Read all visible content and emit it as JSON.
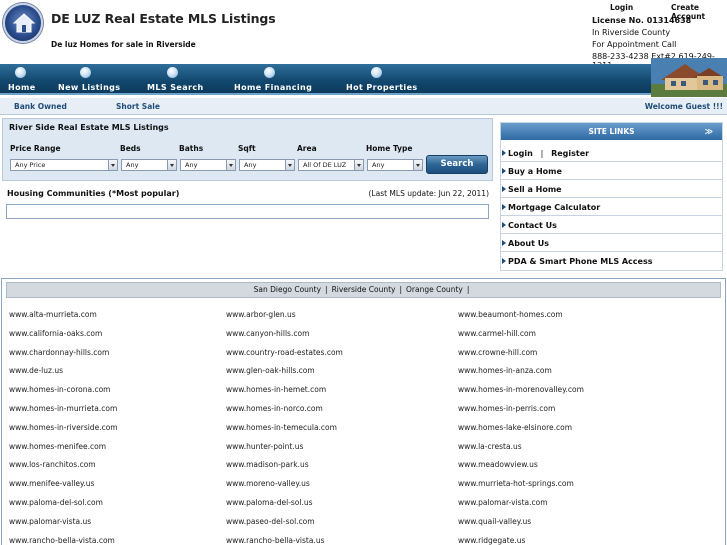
{
  "header": {
    "title": "DE LUZ Real Estate MLS Listings",
    "subtitle": "De luz Homes for sale in Riverside",
    "top_login": "Login",
    "top_create": "Create Account",
    "license": "License No. 01314638",
    "contact_line1": "In Riverside County",
    "contact_line2": "For Appointment Call",
    "contact_line3": "888-233-4238 Ext#2,619-249-1211"
  },
  "nav": {
    "items": [
      {
        "label": "Home",
        "icon": "home-icon"
      },
      {
        "label": "New Listings",
        "icon": "new-listings-icon"
      },
      {
        "label": "MLS Search",
        "icon": "mls-search-icon"
      },
      {
        "label": "Home Financing",
        "icon": "home-financing-icon"
      },
      {
        "label": "Hot Properties",
        "icon": "hot-properties-icon"
      }
    ]
  },
  "subnav": {
    "bank_owned": "Bank Owned",
    "short_sale": "Short Sale",
    "welcome": "Welcome  Guest !!!"
  },
  "search": {
    "title": "River Side Real Estate MLS Listings",
    "fields": [
      {
        "label": "Price Range",
        "value": "Any Price"
      },
      {
        "label": "Beds",
        "value": "Any"
      },
      {
        "label": "Baths",
        "value": "Any"
      },
      {
        "label": "Sqft",
        "value": "Any"
      },
      {
        "label": "Area",
        "value": "All Of DE LUZ"
      },
      {
        "label": "Home Type",
        "value": "Any"
      }
    ],
    "button": "Search"
  },
  "housing": {
    "title": "Housing Communities (*Most popular)",
    "update": "(Last MLS update: Jun 22, 2011)"
  },
  "sidebar": {
    "heading": "SITE LINKS",
    "heading_icon": "double-chevron-icon",
    "login": "Login",
    "separator": "|",
    "register": "Register",
    "items": [
      "Buy a Home",
      "Sell a Home",
      "Mortgage Calculator",
      "Contact Us",
      "About Us",
      "PDA & Smart Phone MLS Access"
    ]
  },
  "counties": {
    "items": [
      "San Diego County",
      "Riverside County",
      "Orange County"
    ],
    "separator": "|"
  },
  "links": {
    "rows": [
      [
        "www.alta-murrieta.com",
        "www.arbor-glen.us",
        "www.beaumont-homes.com"
      ],
      [
        "www.california-oaks.com",
        "www.canyon-hills.com",
        "www.carmel-hill.com"
      ],
      [
        "www.chardonnay-hills.com",
        "www.country-road-estates.com",
        "www.crowne-hill.com"
      ],
      [
        "www.de-luz.us",
        "www.glen-oak-hills.com",
        "www.homes-in-anza.com"
      ],
      [
        "www.homes-in-corona.com",
        "www.homes-in-hemet.com",
        "www.homes-in-morenovalley.com"
      ],
      [
        "www.homes-in-murrieta.com",
        "www.homes-in-norco.com",
        "www.homes-in-perris.com"
      ],
      [
        "www.homes-in-riverside.com",
        "www.homes-in-temecula.com",
        "www.homes-lake-elsinore.com"
      ],
      [
        "www.homes-menifee.com",
        "www.hunter-point.us",
        "www.la-cresta.us"
      ],
      [
        "www.los-ranchitos.com",
        "www.madison-park.us",
        "www.meadowview.us"
      ],
      [
        "www.menifee-valley.us",
        "www.moreno-valley.us",
        "www.murrieta-hot-springs.com"
      ],
      [
        "www.paloma-del-sol.com",
        "www.paloma-del-sol.us",
        "www.palomar-vista.com"
      ],
      [
        "www.palomar-vista.us",
        "www.paseo-del-sol.com",
        "www.quail-valley.us"
      ],
      [
        "www.rancho-bella-vista.com",
        "www.rancho-bella-vista.us",
        "www.ridgegate.us"
      ]
    ]
  }
}
